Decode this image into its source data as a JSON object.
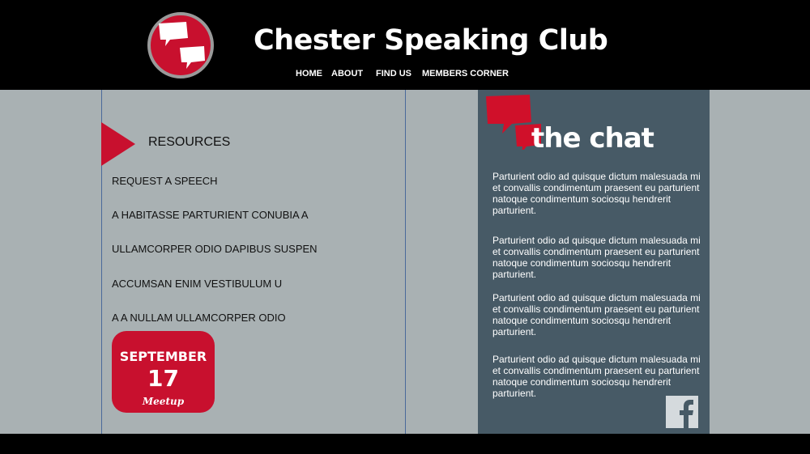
{
  "header": {
    "title": "Chester Speaking Club",
    "logo_icon": "speech-bubbles-icon"
  },
  "nav": {
    "items": [
      {
        "label": "HOME"
      },
      {
        "label": "ABOUT"
      },
      {
        "label": "FIND US"
      },
      {
        "label": "MEMBERS CORNER"
      }
    ]
  },
  "resources": {
    "title": "RESOURCES",
    "links": [
      {
        "label": "REQUEST A SPEECH"
      },
      {
        "label": "A HABITASSE PARTURIENT CONUBIA A"
      },
      {
        "label": "ULLAMCORPER ODIO DAPIBUS SUSPEN"
      },
      {
        "label": "ACCUMSAN ENIM VESTIBULUM U"
      },
      {
        "label": "A A NULLAM ULLAMCORPER ODIO"
      }
    ]
  },
  "meetup": {
    "month": "SEPTEMBER",
    "day": "17",
    "label": "Meetup"
  },
  "chat": {
    "title": "the chat",
    "paragraphs": [
      "Parturient odio ad quisque dictum malesuada mi et convallis condimentum praesent eu parturient natoque condimentum sociosqu hendrerit parturient.",
      "Parturient odio ad quisque dictum malesuada mi et convallis condimentum praesent eu parturient natoque condimentum sociosqu hendrerit parturient.",
      "Parturient odio ad quisque dictum malesuada mi et convallis condimentum praesent eu parturient natoque condimentum sociosqu hendrerit parturient.",
      "Parturient odio ad quisque dictum malesuada mi et convallis condimentum praesent eu parturient natoque condimentum sociosqu hendrerit parturient."
    ],
    "social_icon": "facebook-icon"
  },
  "colors": {
    "brand_red": "#c8102e",
    "panel_bg": "#475a66",
    "main_bg": "#a9b1b3",
    "header_bg": "#000000"
  }
}
